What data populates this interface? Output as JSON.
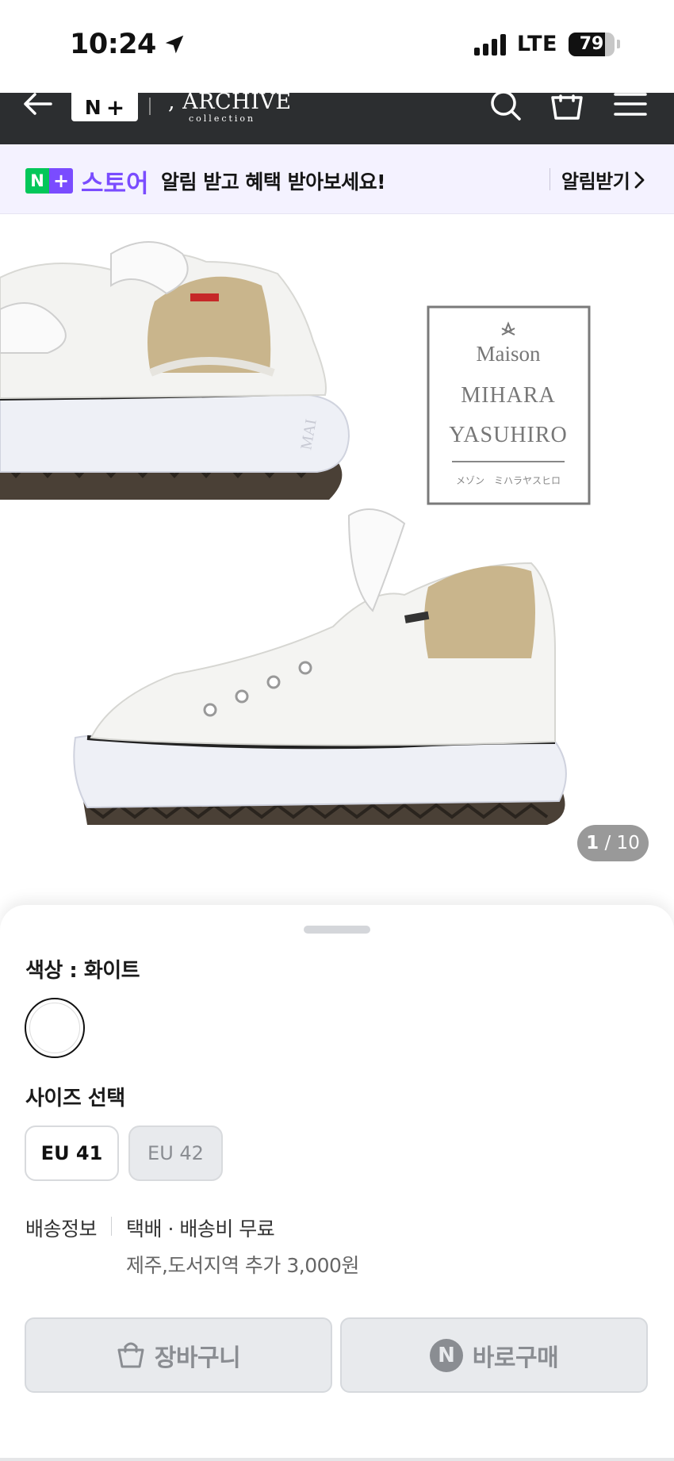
{
  "status_bar": {
    "time": "10:24",
    "network": "LTE",
    "battery": "79",
    "battery_level": 0.79
  },
  "header": {
    "logo_n": "N",
    "logo_plus": "+",
    "brand": ", ARCHIVE",
    "brand_sub": "collection"
  },
  "banner": {
    "badge_n": "N",
    "badge_plus": "+",
    "store_label": "스토어",
    "message": "알림 받고 혜택 받아보세요!",
    "action": "알림받기"
  },
  "product_image": {
    "logo_line1": "Maison",
    "logo_line2": "MIHARA",
    "logo_line3": "YASUHIRO",
    "logo_line4": "メゾン　ミハラヤスヒロ",
    "sole_text": "MAI",
    "counter_current": "1",
    "counter_total": "/ 10"
  },
  "options": {
    "color_label": "색상 : 화이트",
    "size_label": "사이즈 선택",
    "sizes": [
      "EU 41",
      "EU 42"
    ]
  },
  "shipping": {
    "label": "배송정보",
    "value": "택배 · 배송비 무료",
    "extra": "제주,도서지역 추가 3,000원"
  },
  "actions": {
    "cart": "장바구니",
    "buy_badge": "N",
    "buy": "바로구매"
  },
  "colors": {
    "npay_green": "#03c75a",
    "store_purple": "#7a4cff",
    "header_bg": "#2c2e30",
    "banner_bg": "#f4f2ff"
  }
}
